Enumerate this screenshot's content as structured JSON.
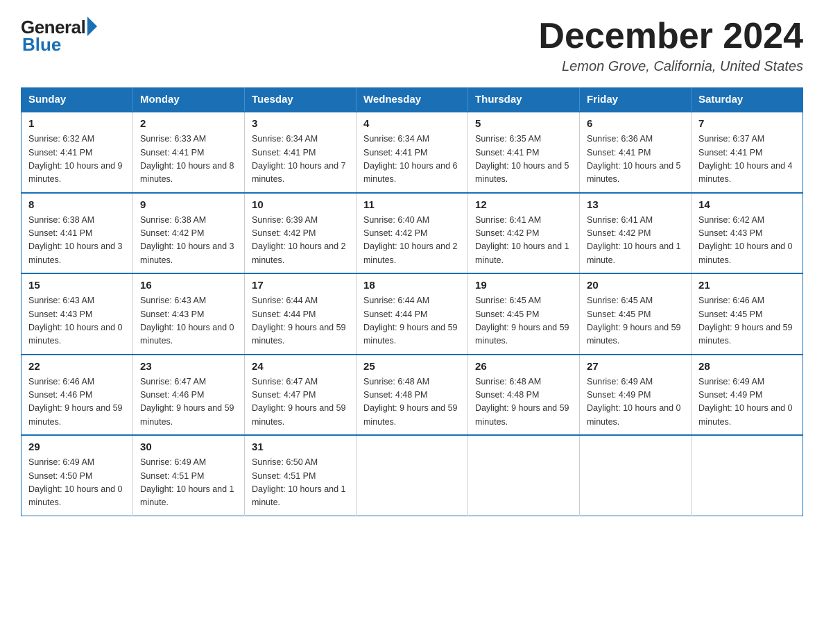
{
  "header": {
    "logo_general": "General",
    "logo_blue": "Blue",
    "month_title": "December 2024",
    "location": "Lemon Grove, California, United States"
  },
  "days_of_week": [
    "Sunday",
    "Monday",
    "Tuesday",
    "Wednesday",
    "Thursday",
    "Friday",
    "Saturday"
  ],
  "weeks": [
    [
      {
        "day": "1",
        "sunrise": "6:32 AM",
        "sunset": "4:41 PM",
        "daylight": "10 hours and 9 minutes."
      },
      {
        "day": "2",
        "sunrise": "6:33 AM",
        "sunset": "4:41 PM",
        "daylight": "10 hours and 8 minutes."
      },
      {
        "day": "3",
        "sunrise": "6:34 AM",
        "sunset": "4:41 PM",
        "daylight": "10 hours and 7 minutes."
      },
      {
        "day": "4",
        "sunrise": "6:34 AM",
        "sunset": "4:41 PM",
        "daylight": "10 hours and 6 minutes."
      },
      {
        "day": "5",
        "sunrise": "6:35 AM",
        "sunset": "4:41 PM",
        "daylight": "10 hours and 5 minutes."
      },
      {
        "day": "6",
        "sunrise": "6:36 AM",
        "sunset": "4:41 PM",
        "daylight": "10 hours and 5 minutes."
      },
      {
        "day": "7",
        "sunrise": "6:37 AM",
        "sunset": "4:41 PM",
        "daylight": "10 hours and 4 minutes."
      }
    ],
    [
      {
        "day": "8",
        "sunrise": "6:38 AM",
        "sunset": "4:41 PM",
        "daylight": "10 hours and 3 minutes."
      },
      {
        "day": "9",
        "sunrise": "6:38 AM",
        "sunset": "4:42 PM",
        "daylight": "10 hours and 3 minutes."
      },
      {
        "day": "10",
        "sunrise": "6:39 AM",
        "sunset": "4:42 PM",
        "daylight": "10 hours and 2 minutes."
      },
      {
        "day": "11",
        "sunrise": "6:40 AM",
        "sunset": "4:42 PM",
        "daylight": "10 hours and 2 minutes."
      },
      {
        "day": "12",
        "sunrise": "6:41 AM",
        "sunset": "4:42 PM",
        "daylight": "10 hours and 1 minute."
      },
      {
        "day": "13",
        "sunrise": "6:41 AM",
        "sunset": "4:42 PM",
        "daylight": "10 hours and 1 minute."
      },
      {
        "day": "14",
        "sunrise": "6:42 AM",
        "sunset": "4:43 PM",
        "daylight": "10 hours and 0 minutes."
      }
    ],
    [
      {
        "day": "15",
        "sunrise": "6:43 AM",
        "sunset": "4:43 PM",
        "daylight": "10 hours and 0 minutes."
      },
      {
        "day": "16",
        "sunrise": "6:43 AM",
        "sunset": "4:43 PM",
        "daylight": "10 hours and 0 minutes."
      },
      {
        "day": "17",
        "sunrise": "6:44 AM",
        "sunset": "4:44 PM",
        "daylight": "9 hours and 59 minutes."
      },
      {
        "day": "18",
        "sunrise": "6:44 AM",
        "sunset": "4:44 PM",
        "daylight": "9 hours and 59 minutes."
      },
      {
        "day": "19",
        "sunrise": "6:45 AM",
        "sunset": "4:45 PM",
        "daylight": "9 hours and 59 minutes."
      },
      {
        "day": "20",
        "sunrise": "6:45 AM",
        "sunset": "4:45 PM",
        "daylight": "9 hours and 59 minutes."
      },
      {
        "day": "21",
        "sunrise": "6:46 AM",
        "sunset": "4:45 PM",
        "daylight": "9 hours and 59 minutes."
      }
    ],
    [
      {
        "day": "22",
        "sunrise": "6:46 AM",
        "sunset": "4:46 PM",
        "daylight": "9 hours and 59 minutes."
      },
      {
        "day": "23",
        "sunrise": "6:47 AM",
        "sunset": "4:46 PM",
        "daylight": "9 hours and 59 minutes."
      },
      {
        "day": "24",
        "sunrise": "6:47 AM",
        "sunset": "4:47 PM",
        "daylight": "9 hours and 59 minutes."
      },
      {
        "day": "25",
        "sunrise": "6:48 AM",
        "sunset": "4:48 PM",
        "daylight": "9 hours and 59 minutes."
      },
      {
        "day": "26",
        "sunrise": "6:48 AM",
        "sunset": "4:48 PM",
        "daylight": "9 hours and 59 minutes."
      },
      {
        "day": "27",
        "sunrise": "6:49 AM",
        "sunset": "4:49 PM",
        "daylight": "10 hours and 0 minutes."
      },
      {
        "day": "28",
        "sunrise": "6:49 AM",
        "sunset": "4:49 PM",
        "daylight": "10 hours and 0 minutes."
      }
    ],
    [
      {
        "day": "29",
        "sunrise": "6:49 AM",
        "sunset": "4:50 PM",
        "daylight": "10 hours and 0 minutes."
      },
      {
        "day": "30",
        "sunrise": "6:49 AM",
        "sunset": "4:51 PM",
        "daylight": "10 hours and 1 minute."
      },
      {
        "day": "31",
        "sunrise": "6:50 AM",
        "sunset": "4:51 PM",
        "daylight": "10 hours and 1 minute."
      },
      null,
      null,
      null,
      null
    ]
  ]
}
